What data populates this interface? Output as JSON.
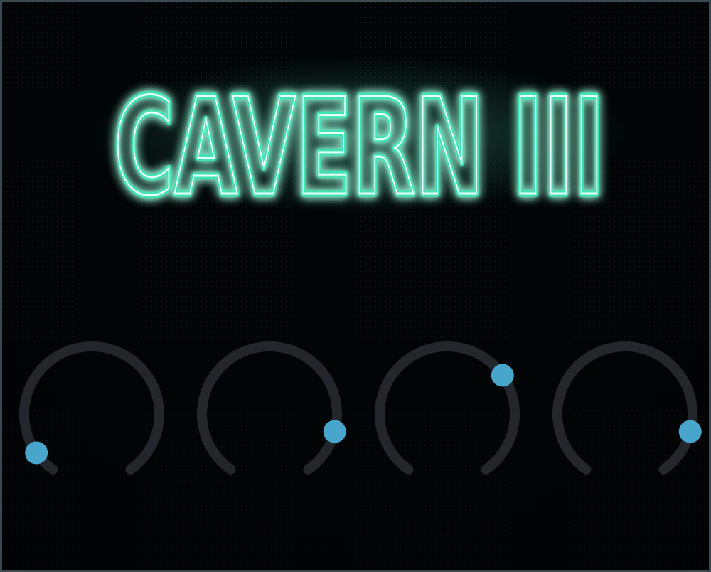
{
  "plugin": {
    "title": "CAVERN III"
  },
  "colors": {
    "logo_glow": "#3fe3b4",
    "logo_core": "#eafff8",
    "knob_track": "#23272b",
    "knob_indicator": "#48a6cc"
  },
  "knobs": [
    {
      "id": "knob-1",
      "value": 0.0
    },
    {
      "id": "knob-2",
      "value": 0.92
    },
    {
      "id": "knob-3",
      "value": 0.72
    },
    {
      "id": "knob-4",
      "value": 0.92
    }
  ]
}
